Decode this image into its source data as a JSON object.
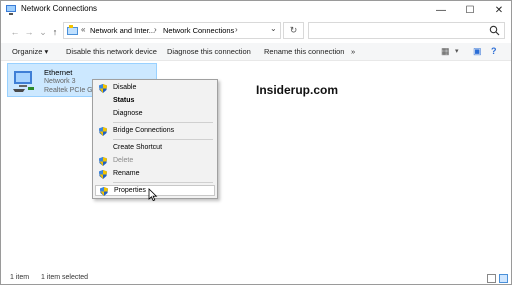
{
  "window": {
    "title": "Network Connections"
  },
  "window_controls": {
    "minimize": "—",
    "maximize": "☐",
    "close": "✕"
  },
  "nav": {
    "back": "←",
    "forward": "→",
    "recent": "⌄",
    "up": "↑"
  },
  "address": {
    "overflow": "«",
    "crumbs": [
      "Network and Inter...",
      "Network Connections"
    ],
    "separator": "›",
    "dropdown": "⌄"
  },
  "refresh": "↻",
  "commands": {
    "organize": "Organize ▾",
    "disable": "Disable this network device",
    "diagnose": "Diagnose this connection",
    "rename": "Rename this connection",
    "more": "»"
  },
  "connection": {
    "name": "Ethernet",
    "network": "Network 3",
    "adapter": "Realtek PCIe Gb"
  },
  "watermark": "Insiderup.com",
  "context_menu": {
    "items": [
      {
        "label": "Disable",
        "shield": true
      },
      {
        "label": "Status",
        "bold": true
      },
      {
        "label": "Diagnose"
      },
      {
        "label": "Bridge Connections",
        "shield": true
      },
      {
        "label": "Create Shortcut"
      },
      {
        "label": "Delete",
        "shield": true,
        "disabled": true
      },
      {
        "label": "Rename",
        "shield": true
      },
      {
        "label": "Properties",
        "shield": true,
        "hover": true
      }
    ]
  },
  "status": {
    "count": "1 item",
    "selected": "1 item selected"
  },
  "colors": {
    "selection": "#cce8ff",
    "shield_blue": "#1f5fbf",
    "shield_yellow": "#f2c300"
  }
}
